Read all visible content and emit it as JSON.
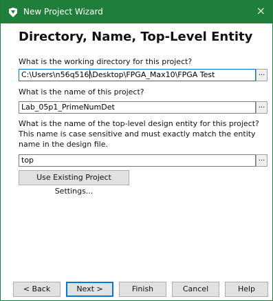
{
  "window": {
    "title": "New Project Wizard",
    "close_glyph": "×"
  },
  "page": {
    "heading": "Directory, Name, Top-Level Entity"
  },
  "fields": {
    "working_dir": {
      "label": "What is the working directory for this project?",
      "value_before_caret": "C:\\Users\\n56q516",
      "value_after_caret": "\\Desktop\\FPGA_Max10\\FPGA Test",
      "browse_label": "..."
    },
    "project_name": {
      "label": "What is the name of this project?",
      "value": "Lab_05p1_PrimeNumDet",
      "browse_label": "..."
    },
    "top_entity": {
      "label": "What is the name of the top-level design entity for this project? This name is case sensitive and must exactly match the entity name in the design file.",
      "value": "top",
      "browse_label": "..."
    }
  },
  "buttons": {
    "use_existing": "Use Existing Project Settings...",
    "back": "< Back",
    "next": "Next >",
    "finish": "Finish",
    "cancel": "Cancel",
    "help": "Help"
  },
  "colors": {
    "titlebar": "#1f7f3a",
    "focus_border": "#0078d7"
  },
  "icons": {
    "app": "quartus-app-icon",
    "close": "close-icon"
  }
}
